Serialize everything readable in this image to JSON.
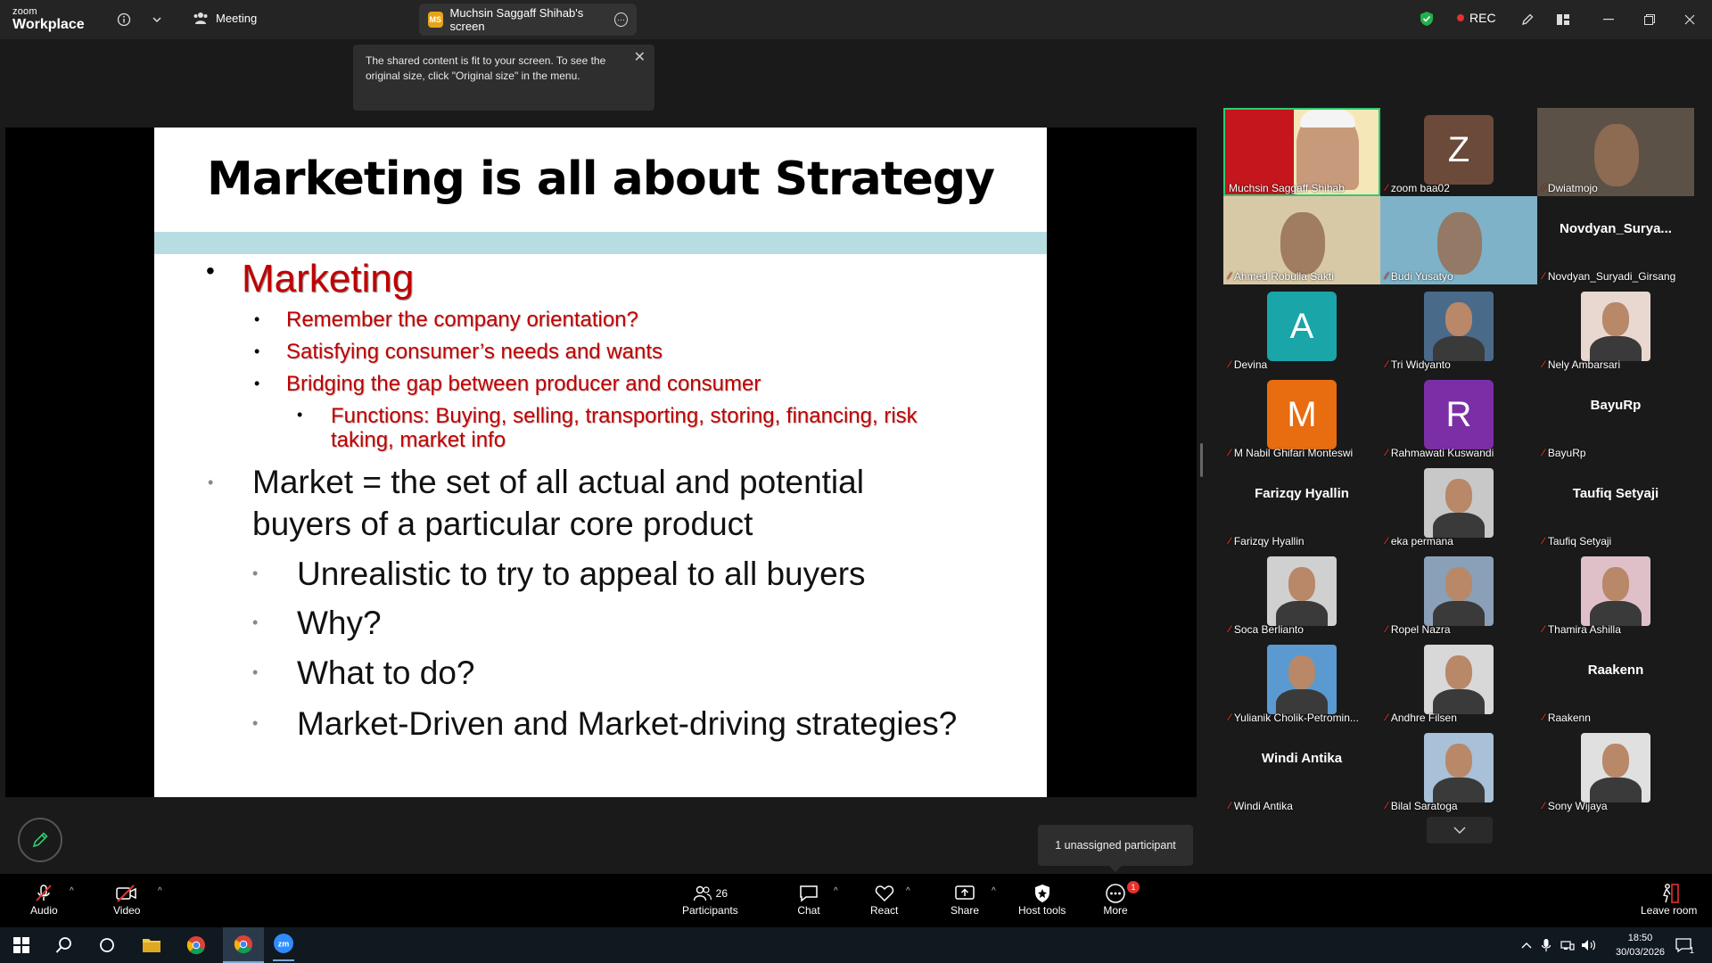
{
  "titlebar": {
    "logo_top": "zoom",
    "logo_bottom": "Workplace",
    "meeting_tab": "Meeting",
    "screen_tab": "Muchsin Saggaff Shihab's screen",
    "screen_tab_badge": "MS",
    "rec_label": "REC"
  },
  "tooltip": {
    "text": "The shared content is fit to your screen. To see the original size, click \"Original size\" in the menu."
  },
  "slide": {
    "title": "Marketing is all about Strategy",
    "main_bullet": "Marketing",
    "sub_bullets": [
      "Remember the company orientation?",
      "Satisfying consumer’s needs and wants",
      "Bridging the gap between producer and consumer"
    ],
    "functions": "Functions: Buying, selling, transporting, storing, financing, risk taking, market info",
    "market_line1": "Market = the set of all actual and potential",
    "market_line2": "buyers of a particular core product",
    "market_sub": [
      "Unrealistic to try to appeal to all buyers",
      "Why?",
      "What to do?",
      "Market-Driven and Market-driving strategies?"
    ]
  },
  "gallery": {
    "participants": [
      {
        "name": "Muchsin Saggaff Shihab",
        "type": "video",
        "bg": "#c4161c"
      },
      {
        "name": "zoom baa02",
        "type": "avatar",
        "letter": "Z",
        "color": "#6b4a3a"
      },
      {
        "name": "Dwiatmojo",
        "type": "video",
        "bg": "#5b5146"
      },
      {
        "name": "Ahmed Robulla Sakti",
        "type": "video",
        "bg": "#d8c9a6"
      },
      {
        "name": "Budi Yusatyo",
        "type": "video",
        "bg": "#7eb2c8"
      },
      {
        "name": "Novdyan_Suryadi_Girsang",
        "type": "name",
        "display": "Novdyan_Surya..."
      },
      {
        "name": "Devina",
        "type": "avatar",
        "letter": "A",
        "color": "#1aa5a8"
      },
      {
        "name": "Tri Widyanto",
        "type": "photo",
        "bg": "#4a6a8a"
      },
      {
        "name": "Nely Ambarsari",
        "type": "photo",
        "bg": "#e8d8d0"
      },
      {
        "name": "M Nabil Ghifari Monteswi",
        "type": "avatar",
        "letter": "M",
        "color": "#e86c10"
      },
      {
        "name": "Rahmawati Kuswandi",
        "type": "avatar",
        "letter": "R",
        "color": "#7b2ea6"
      },
      {
        "name": "BayuRp",
        "type": "name",
        "display": "BayuRp"
      },
      {
        "name": "Farizqy Hyallin",
        "type": "name",
        "display": "Farizqy Hyallin"
      },
      {
        "name": "eka permana",
        "type": "photo",
        "bg": "#c8c8c8"
      },
      {
        "name": "Taufiq Setyaji",
        "type": "name",
        "display": "Taufiq Setyaji"
      },
      {
        "name": "Soca Berlianto",
        "type": "photo",
        "bg": "#d0d0d0"
      },
      {
        "name": "Ropel Nazra",
        "type": "photo",
        "bg": "#8aa0b8"
      },
      {
        "name": "Thamira Ashilla",
        "type": "photo",
        "bg": "#e0c0c8"
      },
      {
        "name": "Yulianik Cholik-Petromin...",
        "type": "photo",
        "bg": "#5a9ad0"
      },
      {
        "name": "Andhre Filsen",
        "type": "photo",
        "bg": "#d8d8d8"
      },
      {
        "name": "Raakenn",
        "type": "name",
        "display": "Raakenn"
      },
      {
        "name": "Windi Antika",
        "type": "name",
        "display": "Windi Antika"
      },
      {
        "name": "Bilal Saratoga",
        "type": "photo",
        "bg": "#a8c0d8"
      },
      {
        "name": "Sony Wijaya",
        "type": "photo",
        "bg": "#e0e0e0"
      }
    ]
  },
  "unassigned": "1 unassigned participant",
  "toolbar": {
    "audio": "Audio",
    "video": "Video",
    "participants": "Participants",
    "participants_count": "26",
    "chat": "Chat",
    "react": "React",
    "share": "Share",
    "host_tools": "Host tools",
    "more": "More",
    "more_badge": "1",
    "leave": "Leave room"
  },
  "taskbar": {
    "time": "18:50",
    "date": "30/03/2026",
    "notif_count": "1"
  }
}
